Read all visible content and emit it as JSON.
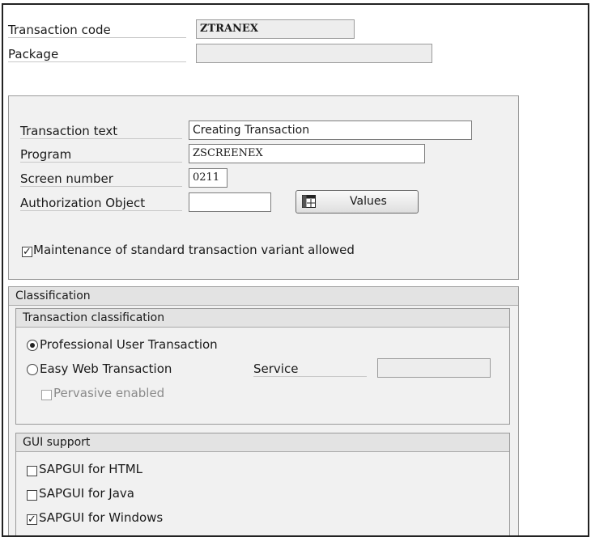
{
  "header": {
    "transaction_code_label": "Transaction code",
    "transaction_code_value": "ZTRANEX",
    "package_label": "Package",
    "package_value": ""
  },
  "details": {
    "transaction_text_label": "Transaction text",
    "transaction_text_value": "Creating Transaction",
    "program_label": "Program",
    "program_value": "ZSCREENEX",
    "screen_number_label": "Screen number",
    "screen_number_value": "0211",
    "auth_object_label": "Authorization Object",
    "auth_object_value": "",
    "values_button_label": "Values",
    "maintenance_label": "Maintenance of standard transaction variant allowed",
    "maintenance_checked": true
  },
  "classification": {
    "title": "Classification",
    "transaction_classification": {
      "title": "Transaction classification",
      "professional_label": "Professional User Transaction",
      "easy_web_label": "Easy Web Transaction",
      "selected": "professional",
      "service_label": "Service",
      "service_value": "",
      "pervasive_label": "Pervasive enabled"
    },
    "gui_support": {
      "title": "GUI support",
      "html_label": "SAPGUI for HTML",
      "java_label": "SAPGUI for Java",
      "windows_label": "SAPGUI for Windows",
      "html_checked": false,
      "java_checked": false,
      "windows_checked": true
    }
  },
  "icons": {
    "values_button_icon": "table-grid-icon"
  }
}
